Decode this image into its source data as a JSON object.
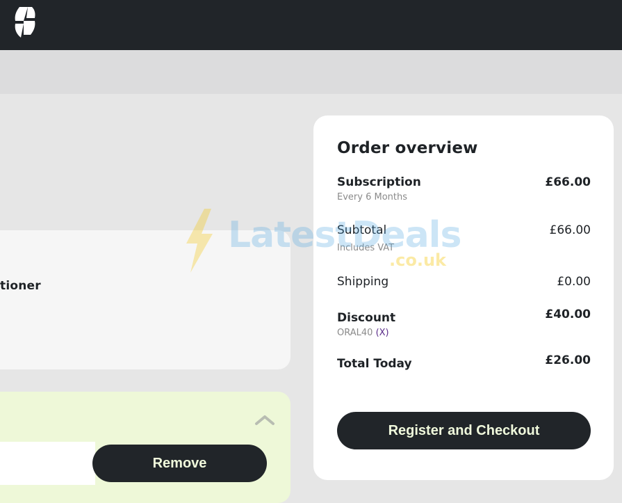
{
  "header": {
    "logo_icon": "brand-logo-icon"
  },
  "product_card": {
    "title_fragment": "tioner"
  },
  "discount_card": {
    "chevron_icon": "chevron-up-icon",
    "code_input_value": "",
    "remove_label": "Remove"
  },
  "order_overview": {
    "title": "Order overview",
    "subscription": {
      "label": "Subscription",
      "value": "£66.00",
      "sub": "Every 6 Months"
    },
    "subtotal": {
      "label": "Subtotal",
      "value": "£66.00",
      "sub": "Includes VAT"
    },
    "shipping": {
      "label": "Shipping",
      "value": "£0.00"
    },
    "discount": {
      "label": "Discount",
      "value": "£40.00",
      "code": "ORAL40",
      "remove": "(X)"
    },
    "total": {
      "label": "Total Today",
      "value": "£26.00"
    },
    "checkout_label": "Register and Checkout"
  },
  "watermark": {
    "text": "LatestDeals",
    "sub": ".co.uk"
  },
  "colors": {
    "dark": "#212529",
    "accent_text": "#f0f9dc",
    "green_card": "#eef8d8"
  }
}
